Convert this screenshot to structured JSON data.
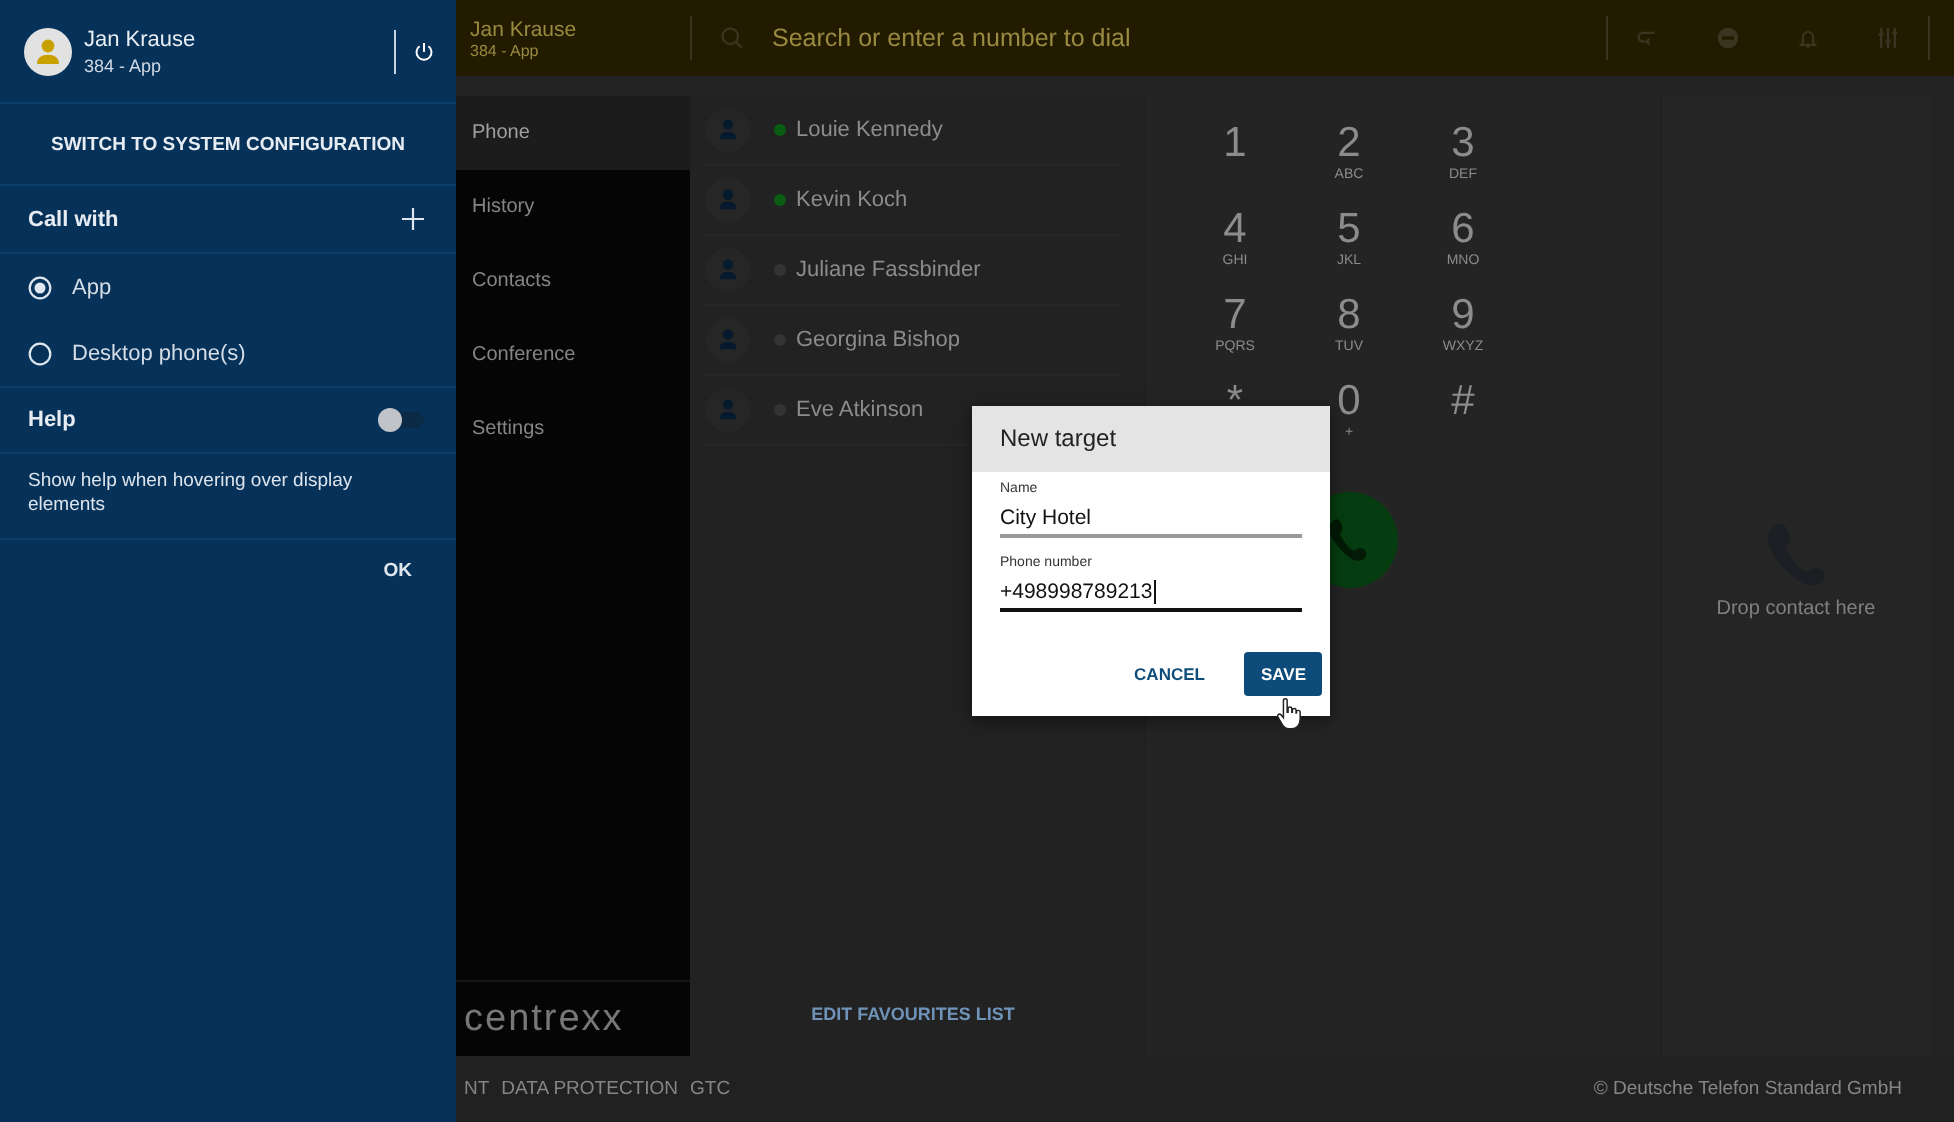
{
  "drawer": {
    "user": {
      "name": "Jan Krause",
      "extension": "384 - App"
    },
    "switch_button": "SWITCH TO SYSTEM CONFIGURATION",
    "call_with": {
      "title": "Call with",
      "options": [
        {
          "label": "App",
          "selected": true
        },
        {
          "label": "Desktop phone(s)",
          "selected": false
        }
      ]
    },
    "help": {
      "title": "Help",
      "on": false,
      "description": "Show help when hovering over display elements"
    },
    "ok_button": "OK"
  },
  "top_bar": {
    "user": {
      "name": "Jan Krause",
      "extension": "384 - App"
    },
    "search": {
      "placeholder": "Search or enter a number to dial"
    }
  },
  "nav": {
    "items": [
      {
        "label": "Phone",
        "selected": true
      },
      {
        "label": "History",
        "selected": false
      },
      {
        "label": "Contacts",
        "selected": false
      },
      {
        "label": "Conference",
        "selected": false
      },
      {
        "label": "Settings",
        "selected": false
      }
    ],
    "logo": "centrexx"
  },
  "favourites": {
    "contacts": [
      {
        "name": "Louie Kennedy",
        "color": "#0a5c12"
      },
      {
        "name": "Kevin Koch",
        "color": "#0a5c12"
      },
      {
        "name": "Juliane Fassbinder",
        "color": "#333333"
      },
      {
        "name": "Georgina Bishop",
        "color": "#333333"
      },
      {
        "name": "Eve Atkinson",
        "color": "#333333"
      }
    ],
    "edit_link": "EDIT FAVOURITES LIST"
  },
  "dialpad": {
    "keys": [
      {
        "digit": "1"
      },
      {
        "digit": "2",
        "letters": "ABC"
      },
      {
        "digit": "3",
        "letters": "DEF"
      },
      {
        "digit": "4",
        "letters": "GHI"
      },
      {
        "digit": "5",
        "letters": "JKL"
      },
      {
        "digit": "6",
        "letters": "MNO"
      },
      {
        "digit": "7",
        "letters": "PQRS"
      },
      {
        "digit": "8",
        "letters": "TUV"
      },
      {
        "digit": "9",
        "letters": "WXYZ"
      },
      {
        "digit": "*"
      },
      {
        "digit": "0",
        "letters": "+"
      },
      {
        "digit": "#"
      }
    ]
  },
  "drop_area": {
    "hint": "Drop contact here"
  },
  "footer": {
    "links": [
      "NT",
      "DATA PROTECTION",
      "GTC"
    ],
    "copyright": "© Deutsche Telefon Standard GmbH"
  },
  "dialog": {
    "title": "New target",
    "fields": [
      {
        "label": "Name",
        "value": "City Hotel",
        "focused": false
      },
      {
        "label": "Phone number",
        "value": "+498998789213",
        "focused": true
      }
    ],
    "buttons": [
      {
        "label": "CANCEL",
        "kind": "text"
      },
      {
        "label": "SAVE",
        "kind": "primary"
      }
    ]
  }
}
